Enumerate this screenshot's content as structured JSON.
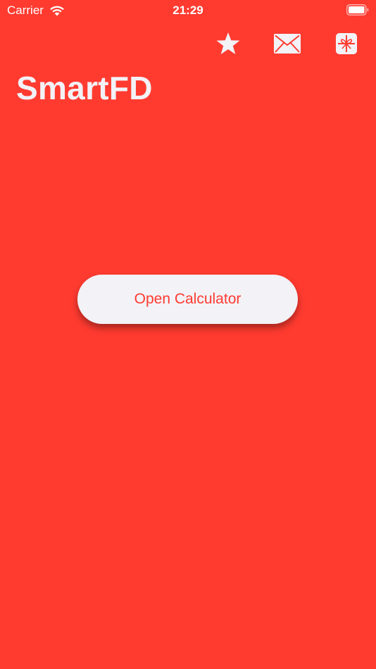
{
  "status_bar": {
    "carrier": "Carrier",
    "time": "21:29",
    "icons": [
      "wifi-icon",
      "battery-icon"
    ]
  },
  "toolbar": {
    "items": [
      {
        "icon": "star-icon"
      },
      {
        "icon": "envelope-icon"
      },
      {
        "icon": "gift-icon"
      }
    ]
  },
  "header": {
    "title": "SmartFD"
  },
  "main": {
    "open_button_label": "Open Calculator"
  },
  "colors": {
    "background": "#FF3B30",
    "foreground": "#F2F2F7",
    "button_text": "#FF3B30"
  }
}
